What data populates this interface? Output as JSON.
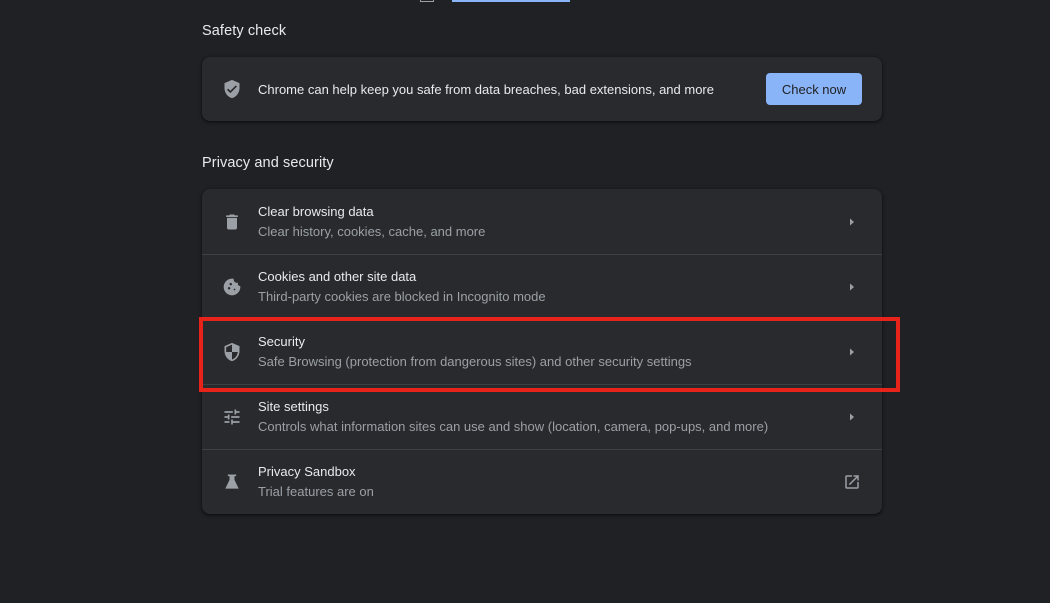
{
  "safety_check": {
    "title": "Safety check",
    "description": "Chrome can help keep you safe from data breaches, bad extensions, and more",
    "button_label": "Check now",
    "icon": "shield-check-icon"
  },
  "privacy_security": {
    "title": "Privacy and security",
    "items": [
      {
        "title": "Clear browsing data",
        "subtitle": "Clear history, cookies, cache, and more",
        "icon": "trash-icon",
        "action": "chevron-right-icon"
      },
      {
        "title": "Cookies and other site data",
        "subtitle": "Third-party cookies are blocked in Incognito mode",
        "icon": "cookie-icon",
        "action": "chevron-right-icon"
      },
      {
        "title": "Security",
        "subtitle": "Safe Browsing (protection from dangerous sites) and other security settings",
        "icon": "shield-icon",
        "action": "chevron-right-icon"
      },
      {
        "title": "Site settings",
        "subtitle": "Controls what information sites can use and show (location, camera, pop-ups, and more)",
        "icon": "tune-icon",
        "action": "chevron-right-icon"
      },
      {
        "title": "Privacy Sandbox",
        "subtitle": "Trial features are on",
        "icon": "flask-icon",
        "action": "external-link-icon"
      }
    ]
  },
  "colors": {
    "background": "#202124",
    "card": "#292a2d",
    "accent": "#8ab4f8",
    "highlight": "#e8241a"
  }
}
